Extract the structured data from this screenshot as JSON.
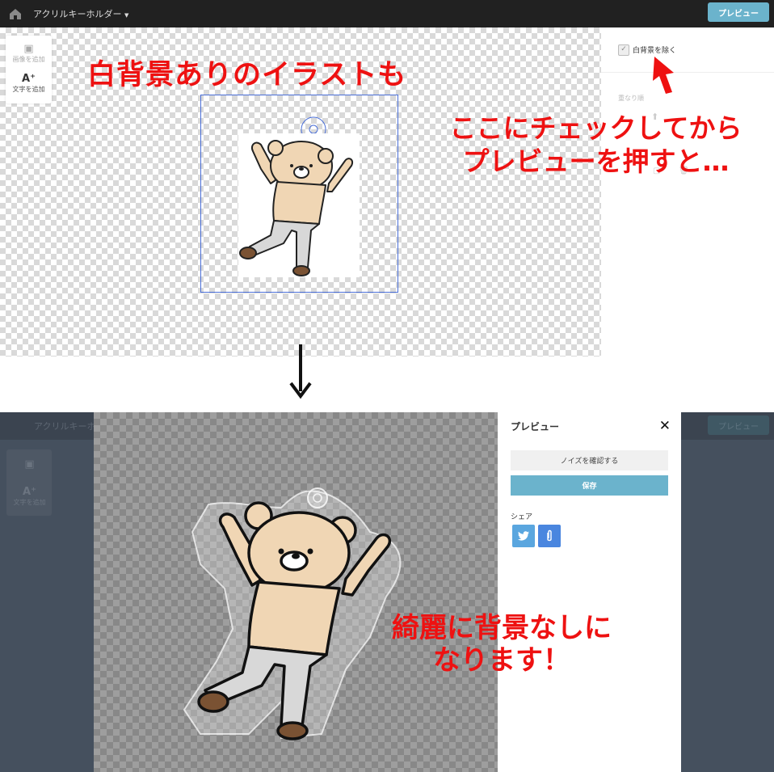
{
  "editor": {
    "app_title": "アクリルキーホルダー",
    "preview_button": "プレビュー",
    "tools": [
      {
        "icon": "image-add-icon",
        "label": "画像を追加"
      },
      {
        "icon": "text-add-icon",
        "glyph": "A⁺",
        "label": "文字を追加"
      }
    ],
    "panel": {
      "remove_white_bg_label": "白背景を除く",
      "remove_white_bg_checked": true,
      "stack_order_label": "重なり順"
    }
  },
  "annotations": {
    "top_caption": "白背景ありのイラストも",
    "instruction_line1": "ここにチェックしてから",
    "instruction_line2": "プレビューを押すと…",
    "result_line1": "綺麗に背景なしに",
    "result_line2": "なります！"
  },
  "preview_modal": {
    "title": "プレビュー",
    "close_glyph": "✕",
    "noise_button": "ノイズを確認する",
    "save_button": "保存",
    "share_label": "シェア",
    "share_icons": [
      "twitter-icon",
      "clip-icon"
    ]
  },
  "colors": {
    "accent": "#6bb3cc",
    "annotation_red": "#ee1111",
    "topbar": "#212121",
    "overlay": "#45505e"
  }
}
